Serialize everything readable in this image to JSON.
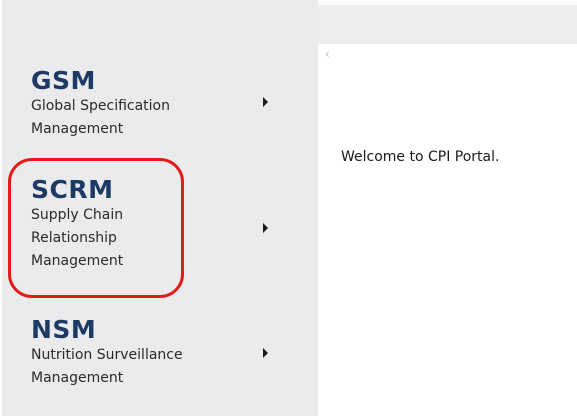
{
  "nav": {
    "items": [
      {
        "title": "GSM",
        "description": "Global Specification Management"
      },
      {
        "title": "SCRM",
        "description": "Supply Chain Relationship Management"
      },
      {
        "title": "NSM",
        "description": "Nutrition Surveillance Management"
      }
    ]
  },
  "main": {
    "collapse_glyph": "‹",
    "welcome_text": "Welcome to CPI Portal."
  },
  "colors": {
    "title": "#1c3a64",
    "highlight": "#e21b1b",
    "sidebar_bg": "#ebebee"
  }
}
